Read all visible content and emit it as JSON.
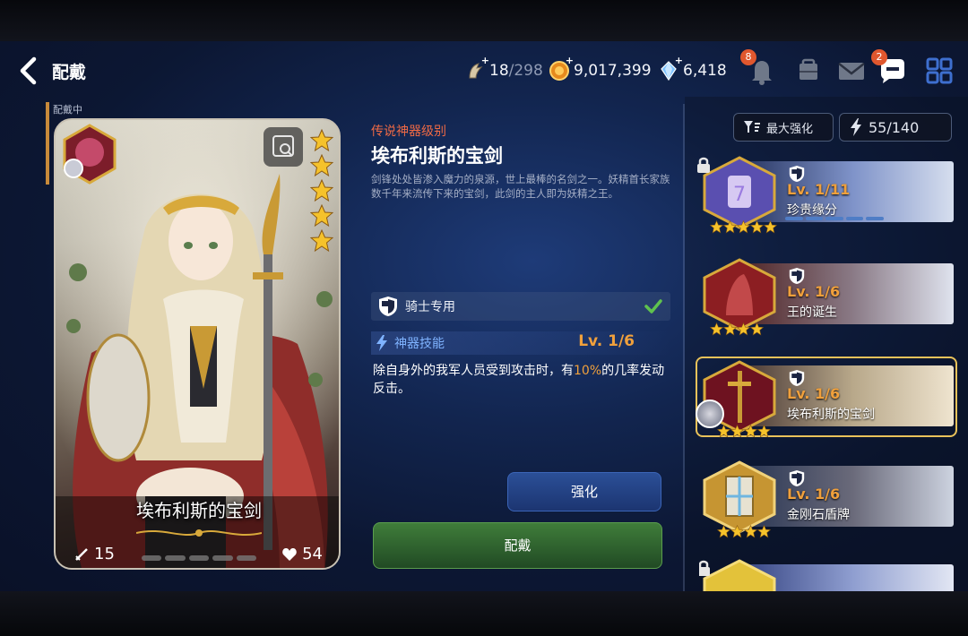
{
  "header": {
    "title": "配戴",
    "stamina": {
      "current": "18",
      "max": "/298"
    },
    "gold": "9,017,399",
    "gems": "6,418",
    "notifications_badge": "8",
    "chat_badge": "2"
  },
  "card": {
    "equipped_label": "配戴中",
    "name": "埃布利斯的宝剑",
    "attack": "15",
    "hp": "54",
    "stars": 5,
    "progress_segments": 5
  },
  "detail": {
    "rarity": "传说神器级别",
    "name": "埃布利斯的宝剑",
    "description": "剑锋处处皆渗入魔力的泉源，世上最棒的名剑之一。妖精首长家族数千年来流传下来的宝剑，此剑的主人即为妖精之王。",
    "restriction": "骑士专用",
    "skill_title": "神器技能",
    "skill_level": "Lv. 1",
    "skill_level_max": "/6",
    "skill_desc_before": "除自身外的我军人员受到攻击时，有",
    "skill_desc_highlight": "10%",
    "skill_desc_after": "的几率发动反击。",
    "upgrade_label": "强化",
    "equip_label": "配戴"
  },
  "panel": {
    "sort_label": "最大强化",
    "capacity": "55/140",
    "items": [
      {
        "level": "Lv. 1/11",
        "name": "珍贵缘分",
        "locked": true,
        "selected": false
      },
      {
        "level": "Lv. 1/6",
        "name": "王的诞生",
        "locked": false,
        "selected": false
      },
      {
        "level": "Lv. 1/6",
        "name": "埃布利斯的宝剑",
        "locked": false,
        "selected": true
      },
      {
        "level": "Lv. 1/6",
        "name": "金刚石盾牌",
        "locked": false,
        "selected": false
      },
      {
        "level": "",
        "name": "",
        "locked": true,
        "selected": false
      }
    ]
  },
  "colors": {
    "accent_orange": "#f0a03c",
    "rarity_red": "#ef6a45",
    "skill_blue": "#7fb3ff",
    "equip_green": "#3f7d3a",
    "upgrade_blue": "#2b4f97"
  },
  "icons": [
    "back-arrow-icon",
    "stamina-icon",
    "gold-coin-icon",
    "gem-icon",
    "bell-icon",
    "inventory-icon",
    "mail-icon",
    "chat-icon",
    "grid-menu-icon",
    "zoom-icon",
    "star-icon",
    "sword-icon",
    "heart-icon",
    "shield-icon",
    "check-icon",
    "lightning-icon",
    "sort-icon",
    "lock-icon"
  ]
}
